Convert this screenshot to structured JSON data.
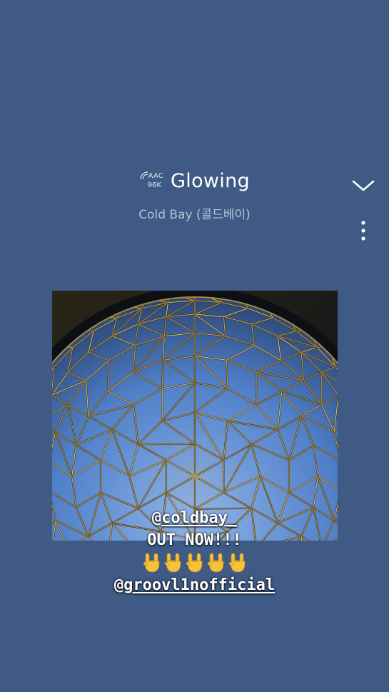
{
  "now_playing": {
    "codec": "AAC",
    "bitrate": "96K",
    "title": "Glowing",
    "artist": "Cold Bay (콜드베이)"
  },
  "icons": {
    "collapse": "chevron-down-icon",
    "more": "more-vertical-icon",
    "codec": "hi-res-arc-icon"
  },
  "story_caption": {
    "mention_at_1": "@",
    "mention_handle_1": "coldbay_",
    "line_2": "OUT NOW!!!",
    "emoji": [
      "sign-of-the-horns",
      "sign-of-the-horns",
      "sign-of-the-horns",
      "sign-of-the-horns",
      "sign-of-the-horns"
    ],
    "mention_at_2": "@",
    "mention_handle_2": "groovl1nofficial"
  },
  "colors": {
    "background": "#3f5a84",
    "artist_text": "#b5c2d8",
    "title_text": "#ffffff"
  }
}
